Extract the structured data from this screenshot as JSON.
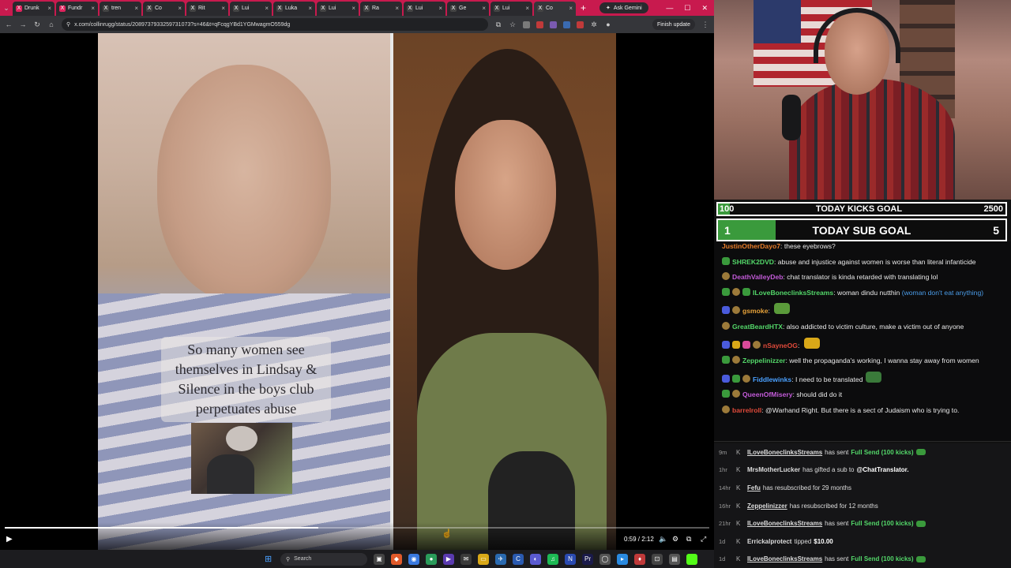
{
  "browser": {
    "tabs": [
      {
        "label": "Drunk",
        "icon": "x",
        "color": "#e0245e"
      },
      {
        "label": "Fundr",
        "icon": "x",
        "color": "#e0245e"
      },
      {
        "label": "tren",
        "icon": "x",
        "color": "#444444"
      },
      {
        "label": "Co",
        "icon": "x",
        "color": "#444444"
      },
      {
        "label": "Rit",
        "icon": "x",
        "color": "#444444"
      },
      {
        "label": "Lui",
        "icon": "x",
        "color": "#444444"
      },
      {
        "label": "Luka",
        "icon": "x",
        "color": "#444444"
      },
      {
        "label": "Lui",
        "icon": "x",
        "color": "#444444"
      },
      {
        "label": "Ra",
        "icon": "x",
        "color": "#444444"
      },
      {
        "label": "Lui",
        "icon": "x",
        "color": "#444444"
      },
      {
        "label": "Ge",
        "icon": "x",
        "color": "#444444"
      },
      {
        "label": "Lui",
        "icon": "x",
        "color": "#444444"
      },
      {
        "label": "Co",
        "icon": "x",
        "color": "#444444"
      }
    ],
    "ask_gemini": "Ask Gemini",
    "url": "x.com/collinrugg/status/2089737933259731073?s=46&t=qFcqgYBd1YGMwagmO559dg",
    "finish_update": "Finish update"
  },
  "video": {
    "caption": "So many women see themselves in Lindsay & Silence in the boys club perpetuates abuse",
    "time": "0:59 / 2:12",
    "progress": 0.445
  },
  "taskbar": {
    "search_placeholder": "Search"
  },
  "stream": {
    "kicks_goal": {
      "current": "100",
      "title": "TODAY KICKS GOAL",
      "target": "2500",
      "progress": 0.04
    },
    "sub_goal": {
      "current": "1",
      "title": "TODAY SUB GOAL",
      "target": "5",
      "progress": 0.2
    },
    "chat": [
      {
        "badges": [],
        "user": "JustinOtherDayo7",
        "color": "#e87d2a",
        "text": "these eyebrows?"
      },
      {
        "badges": [
          "green"
        ],
        "user": "SHREK2DVD",
        "color": "#53d769",
        "text": "abuse and injustice against women is worse than literal infanticide"
      },
      {
        "badges": [
          "gold"
        ],
        "user": "DeathValleyDeb",
        "color": "#c35bd9",
        "text": "chat translator is kinda retarded with translating lol"
      },
      {
        "badges": [
          "green",
          "gold",
          "green"
        ],
        "user": "ILoveBoneclinksStreams",
        "color": "#53d769",
        "text": "woman dindu nutthin",
        "reply": "(woman don't eat anything)"
      },
      {
        "badges": [
          "blue",
          "gold"
        ],
        "user": "gsmoke",
        "color": "#e8a33a",
        "text": "",
        "emote": "#5a9a3a"
      },
      {
        "badges": [
          "gold"
        ],
        "user": "GreatBeardHTX",
        "color": "#53d769",
        "text": "also addicted to victim culture, make a victim out of anyone"
      },
      {
        "badges": [
          "blue",
          "yellow",
          "pink",
          "gold"
        ],
        "user": "nSayneOG",
        "color": "#e04a3a",
        "text": "",
        "emote": "#d9a818"
      },
      {
        "badges": [
          "green",
          "gold"
        ],
        "user": "Zeppelinizzer",
        "color": "#53d769",
        "text": "well the propaganda's working, I wanna stay away from women"
      },
      {
        "badges": [
          "blue",
          "green",
          "gold"
        ],
        "user": "Fiddlewinks",
        "color": "#4aa0ff",
        "text": "I need to be translated",
        "emote": "#3a7a3a"
      },
      {
        "badges": [
          "green",
          "gold"
        ],
        "user": "QueenOfMisery",
        "color": "#c35bd9",
        "text": "should did do it"
      },
      {
        "badges": [
          "gold"
        ],
        "user": "barrelroll",
        "color": "#e04a3a",
        "text": "@Warhand Right. But there is a sect of Judaism who is trying to."
      }
    ],
    "events": [
      {
        "age": "9m",
        "user": "ILoveBoneclinksStreams",
        "text": "has sent",
        "highlight": "Full Send (100 kicks)",
        "chip": true
      },
      {
        "age": "1hr",
        "user": "MrsMotherLucker",
        "text": "has gifted a sub to",
        "bold": "@ChatTranslator."
      },
      {
        "age": "14hr",
        "user": "Fefu",
        "text": "has resubscribed for 29 months"
      },
      {
        "age": "16hr",
        "user": "Zeppelinizzer",
        "text": "has resubscribed for 12 months"
      },
      {
        "age": "21hr",
        "user": "ILoveBoneclinksStreams",
        "text": "has sent",
        "highlight": "Full Send (100 kicks)",
        "chip": true
      },
      {
        "age": "1d",
        "user": "Errickalprotect",
        "text": "tipped",
        "bold": "$10.00"
      },
      {
        "age": "1d",
        "user": "ILoveBoneclinksStreams",
        "text": "has sent",
        "highlight": "Full Send (100 kicks)",
        "chip": true
      }
    ]
  }
}
